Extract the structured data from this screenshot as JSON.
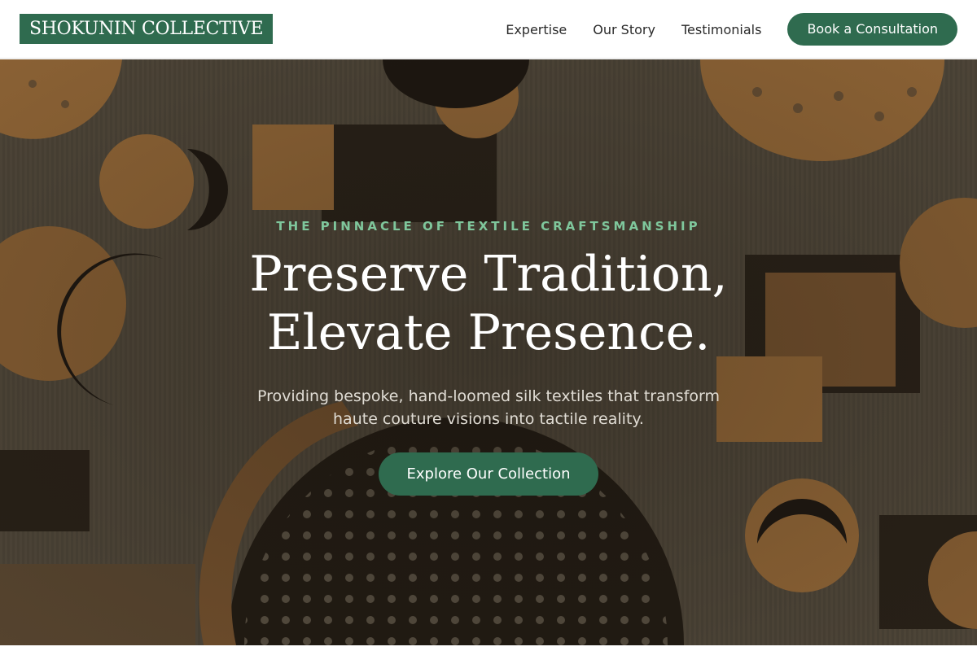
{
  "header": {
    "logo": "SHOKUNIN COLLECTIVE",
    "nav": {
      "expertise": "Expertise",
      "our_story": "Our Story",
      "testimonials": "Testimonials"
    },
    "cta_label": "Book a Consultation"
  },
  "hero": {
    "eyebrow": "THE PINNACLE OF TEXTILE CRAFTSMANSHIP",
    "headline_line1": "Preserve Tradition,",
    "headline_line2": "Elevate Presence.",
    "subtext": "Providing bespoke, hand-loomed silk textiles that transform haute couture visions into tactile reality.",
    "button_label": "Explore Our Collection"
  },
  "colors": {
    "brand_green": "#2f6b4f",
    "eyebrow_green": "#7fc79c",
    "textile_base": "#4d4538",
    "textile_ochre": "#9a6c3a",
    "textile_dark": "#1e1812"
  }
}
